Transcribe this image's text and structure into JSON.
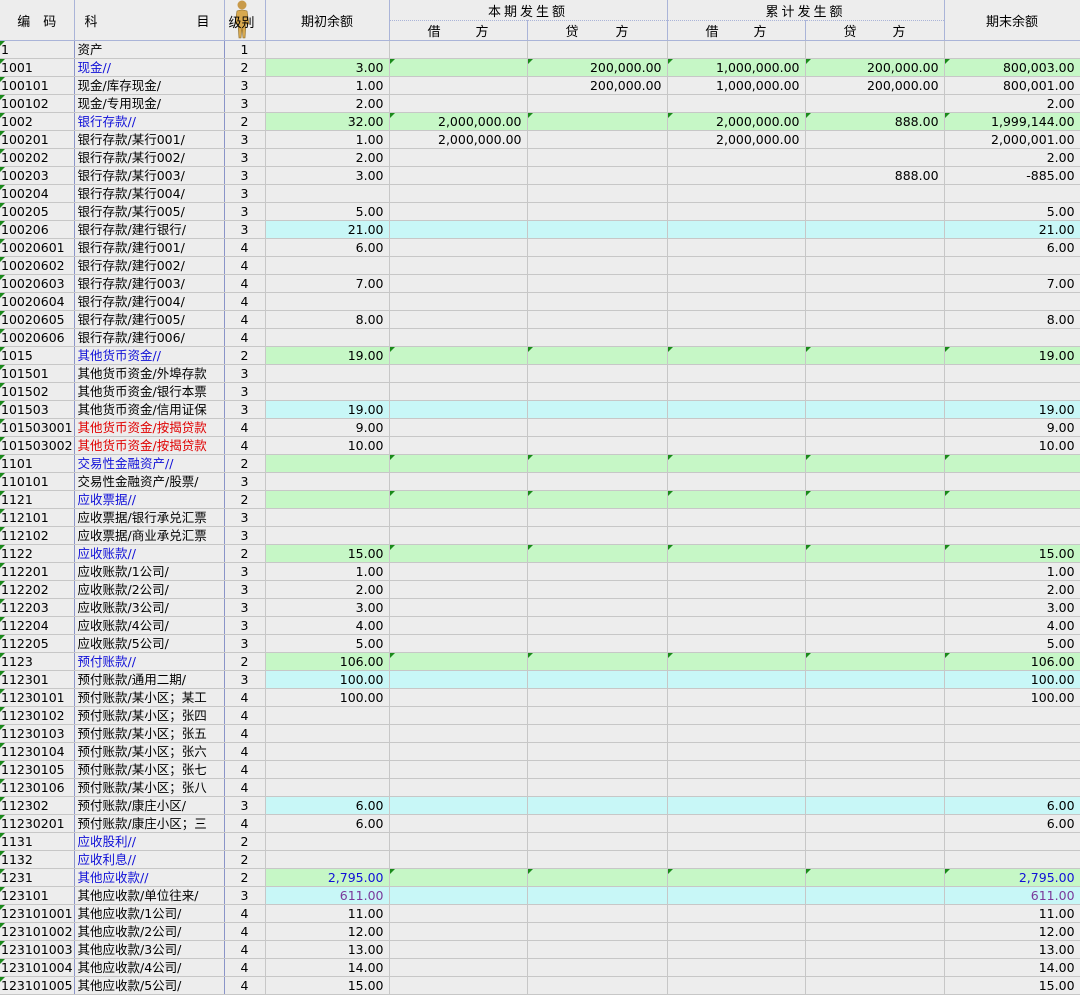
{
  "header": {
    "code": "编　码",
    "name_left": "科",
    "name_right": "目",
    "level": "级别",
    "opening": "期初余额",
    "period": "本期发生额",
    "cumulative": "累计发生额",
    "closing": "期末余额",
    "debit_left": "借",
    "debit_right": "方",
    "credit_left": "贷",
    "credit_right": "方"
  },
  "colors": {
    "header_bg": "#ededed",
    "cell_bg": "#ededed",
    "green_row": "#c6f7c6",
    "cyan_row": "#c8f7f7",
    "blue_text": "#1010d8",
    "red_text": "#e00000"
  },
  "rows": [
    {
      "code": "1",
      "name": "资产",
      "level": "1",
      "opening": "",
      "pd": "",
      "pc": "",
      "cd": "",
      "cc": "",
      "closing": "",
      "style": "",
      "nameColor": "",
      "numColor": ""
    },
    {
      "code": "1001",
      "name": "现金//",
      "level": "2",
      "opening": "3.00",
      "pd": "",
      "pc": "200,000.00",
      "cd": "1,000,000.00",
      "cc": "200,000.00",
      "closing": "800,003.00",
      "style": "green",
      "nameColor": "blue",
      "numColor": ""
    },
    {
      "code": "100101",
      "name": "现金/库存现金/",
      "level": "3",
      "opening": "1.00",
      "pd": "",
      "pc": "200,000.00",
      "cd": "1,000,000.00",
      "cc": "200,000.00",
      "closing": "800,001.00",
      "style": "",
      "nameColor": "",
      "numColor": ""
    },
    {
      "code": "100102",
      "name": "现金/专用现金/",
      "level": "3",
      "opening": "2.00",
      "pd": "",
      "pc": "",
      "cd": "",
      "cc": "",
      "closing": "2.00",
      "style": "",
      "nameColor": "",
      "numColor": ""
    },
    {
      "code": "1002",
      "name": "银行存款//",
      "level": "2",
      "opening": "32.00",
      "pd": "2,000,000.00",
      "pc": "",
      "cd": "2,000,000.00",
      "cc": "888.00",
      "closing": "1,999,144.00",
      "style": "green",
      "nameColor": "blue",
      "numColor": ""
    },
    {
      "code": "100201",
      "name": "银行存款/某行001/",
      "level": "3",
      "opening": "1.00",
      "pd": "2,000,000.00",
      "pc": "",
      "cd": "2,000,000.00",
      "cc": "",
      "closing": "2,000,001.00",
      "style": "",
      "nameColor": "",
      "numColor": ""
    },
    {
      "code": "100202",
      "name": "银行存款/某行002/",
      "level": "3",
      "opening": "2.00",
      "pd": "",
      "pc": "",
      "cd": "",
      "cc": "",
      "closing": "2.00",
      "style": "",
      "nameColor": "",
      "numColor": ""
    },
    {
      "code": "100203",
      "name": "银行存款/某行003/",
      "level": "3",
      "opening": "3.00",
      "pd": "",
      "pc": "",
      "cd": "",
      "cc": "888.00",
      "closing": "-885.00",
      "style": "",
      "nameColor": "",
      "numColor": ""
    },
    {
      "code": "100204",
      "name": "银行存款/某行004/",
      "level": "3",
      "opening": "",
      "pd": "",
      "pc": "",
      "cd": "",
      "cc": "",
      "closing": "",
      "style": "",
      "nameColor": "",
      "numColor": ""
    },
    {
      "code": "100205",
      "name": "银行存款/某行005/",
      "level": "3",
      "opening": "5.00",
      "pd": "",
      "pc": "",
      "cd": "",
      "cc": "",
      "closing": "5.00",
      "style": "",
      "nameColor": "",
      "numColor": ""
    },
    {
      "code": "100206",
      "name": "银行存款/建行银行/",
      "level": "3",
      "opening": "21.00",
      "pd": "",
      "pc": "",
      "cd": "",
      "cc": "",
      "closing": "21.00",
      "style": "cyan",
      "nameColor": "",
      "numColor": ""
    },
    {
      "code": "10020601",
      "name": "银行存款/建行001/",
      "level": "4",
      "opening": "6.00",
      "pd": "",
      "pc": "",
      "cd": "",
      "cc": "",
      "closing": "6.00",
      "style": "",
      "nameColor": "",
      "numColor": ""
    },
    {
      "code": "10020602",
      "name": "银行存款/建行002/",
      "level": "4",
      "opening": "",
      "pd": "",
      "pc": "",
      "cd": "",
      "cc": "",
      "closing": "",
      "style": "",
      "nameColor": "",
      "numColor": ""
    },
    {
      "code": "10020603",
      "name": "银行存款/建行003/",
      "level": "4",
      "opening": "7.00",
      "pd": "",
      "pc": "",
      "cd": "",
      "cc": "",
      "closing": "7.00",
      "style": "",
      "nameColor": "",
      "numColor": ""
    },
    {
      "code": "10020604",
      "name": "银行存款/建行004/",
      "level": "4",
      "opening": "",
      "pd": "",
      "pc": "",
      "cd": "",
      "cc": "",
      "closing": "",
      "style": "",
      "nameColor": "",
      "numColor": ""
    },
    {
      "code": "10020605",
      "name": "银行存款/建行005/",
      "level": "4",
      "opening": "8.00",
      "pd": "",
      "pc": "",
      "cd": "",
      "cc": "",
      "closing": "8.00",
      "style": "",
      "nameColor": "",
      "numColor": ""
    },
    {
      "code": "10020606",
      "name": "银行存款/建行006/",
      "level": "4",
      "opening": "",
      "pd": "",
      "pc": "",
      "cd": "",
      "cc": "",
      "closing": "",
      "style": "",
      "nameColor": "",
      "numColor": ""
    },
    {
      "code": "1015",
      "name": "其他货币资金//",
      "level": "2",
      "opening": "19.00",
      "pd": "",
      "pc": "",
      "cd": "",
      "cc": "",
      "closing": "19.00",
      "style": "green",
      "nameColor": "blue",
      "numColor": ""
    },
    {
      "code": "101501",
      "name": "其他货币资金/外埠存款",
      "level": "3",
      "opening": "",
      "pd": "",
      "pc": "",
      "cd": "",
      "cc": "",
      "closing": "",
      "style": "",
      "nameColor": "",
      "numColor": ""
    },
    {
      "code": "101502",
      "name": "其他货币资金/银行本票",
      "level": "3",
      "opening": "",
      "pd": "",
      "pc": "",
      "cd": "",
      "cc": "",
      "closing": "",
      "style": "",
      "nameColor": "",
      "numColor": ""
    },
    {
      "code": "101503",
      "name": "其他货币资金/信用证保",
      "level": "3",
      "opening": "19.00",
      "pd": "",
      "pc": "",
      "cd": "",
      "cc": "",
      "closing": "19.00",
      "style": "cyan",
      "nameColor": "",
      "numColor": ""
    },
    {
      "code": "101503001",
      "name": "其他货币资金/按揭贷款",
      "level": "4",
      "opening": "9.00",
      "pd": "",
      "pc": "",
      "cd": "",
      "cc": "",
      "closing": "9.00",
      "style": "",
      "nameColor": "red",
      "numColor": ""
    },
    {
      "code": "101503002",
      "name": "其他货币资金/按揭贷款",
      "level": "4",
      "opening": "10.00",
      "pd": "",
      "pc": "",
      "cd": "",
      "cc": "",
      "closing": "10.00",
      "style": "",
      "nameColor": "red",
      "numColor": ""
    },
    {
      "code": "1101",
      "name": "交易性金融资产//",
      "level": "2",
      "opening": "",
      "pd": "",
      "pc": "",
      "cd": "",
      "cc": "",
      "closing": "",
      "style": "green",
      "nameColor": "blue",
      "numColor": ""
    },
    {
      "code": "110101",
      "name": "交易性金融资产/股票/",
      "level": "3",
      "opening": "",
      "pd": "",
      "pc": "",
      "cd": "",
      "cc": "",
      "closing": "",
      "style": "",
      "nameColor": "",
      "numColor": ""
    },
    {
      "code": "1121",
      "name": "应收票据//",
      "level": "2",
      "opening": "",
      "pd": "",
      "pc": "",
      "cd": "",
      "cc": "",
      "closing": "",
      "style": "green",
      "nameColor": "blue",
      "numColor": ""
    },
    {
      "code": "112101",
      "name": "应收票据/银行承兑汇票",
      "level": "3",
      "opening": "",
      "pd": "",
      "pc": "",
      "cd": "",
      "cc": "",
      "closing": "",
      "style": "",
      "nameColor": "",
      "numColor": ""
    },
    {
      "code": "112102",
      "name": "应收票据/商业承兑汇票",
      "level": "3",
      "opening": "",
      "pd": "",
      "pc": "",
      "cd": "",
      "cc": "",
      "closing": "",
      "style": "",
      "nameColor": "",
      "numColor": ""
    },
    {
      "code": "1122",
      "name": "应收账款//",
      "level": "2",
      "opening": "15.00",
      "pd": "",
      "pc": "",
      "cd": "",
      "cc": "",
      "closing": "15.00",
      "style": "green",
      "nameColor": "blue",
      "numColor": ""
    },
    {
      "code": "112201",
      "name": "应收账款/1公司/",
      "level": "3",
      "opening": "1.00",
      "pd": "",
      "pc": "",
      "cd": "",
      "cc": "",
      "closing": "1.00",
      "style": "",
      "nameColor": "",
      "numColor": ""
    },
    {
      "code": "112202",
      "name": "应收账款/2公司/",
      "level": "3",
      "opening": "2.00",
      "pd": "",
      "pc": "",
      "cd": "",
      "cc": "",
      "closing": "2.00",
      "style": "",
      "nameColor": "",
      "numColor": ""
    },
    {
      "code": "112203",
      "name": "应收账款/3公司/",
      "level": "3",
      "opening": "3.00",
      "pd": "",
      "pc": "",
      "cd": "",
      "cc": "",
      "closing": "3.00",
      "style": "",
      "nameColor": "",
      "numColor": ""
    },
    {
      "code": "112204",
      "name": "应收账款/4公司/",
      "level": "3",
      "opening": "4.00",
      "pd": "",
      "pc": "",
      "cd": "",
      "cc": "",
      "closing": "4.00",
      "style": "",
      "nameColor": "",
      "numColor": ""
    },
    {
      "code": "112205",
      "name": "应收账款/5公司/",
      "level": "3",
      "opening": "5.00",
      "pd": "",
      "pc": "",
      "cd": "",
      "cc": "",
      "closing": "5.00",
      "style": "",
      "nameColor": "",
      "numColor": ""
    },
    {
      "code": "1123",
      "name": "预付账款//",
      "level": "2",
      "opening": "106.00",
      "pd": "",
      "pc": "",
      "cd": "",
      "cc": "",
      "closing": "106.00",
      "style": "green",
      "nameColor": "blue",
      "numColor": ""
    },
    {
      "code": "112301",
      "name": "预付账款/通用二期/",
      "level": "3",
      "opening": "100.00",
      "pd": "",
      "pc": "",
      "cd": "",
      "cc": "",
      "closing": "100.00",
      "style": "cyan",
      "nameColor": "",
      "numColor": ""
    },
    {
      "code": "11230101",
      "name": "预付账款/某小区；某工",
      "level": "4",
      "opening": "100.00",
      "pd": "",
      "pc": "",
      "cd": "",
      "cc": "",
      "closing": "100.00",
      "style": "",
      "nameColor": "",
      "numColor": ""
    },
    {
      "code": "11230102",
      "name": "预付账款/某小区；张四",
      "level": "4",
      "opening": "",
      "pd": "",
      "pc": "",
      "cd": "",
      "cc": "",
      "closing": "",
      "style": "",
      "nameColor": "",
      "numColor": ""
    },
    {
      "code": "11230103",
      "name": "预付账款/某小区；张五",
      "level": "4",
      "opening": "",
      "pd": "",
      "pc": "",
      "cd": "",
      "cc": "",
      "closing": "",
      "style": "",
      "nameColor": "",
      "numColor": ""
    },
    {
      "code": "11230104",
      "name": "预付账款/某小区；张六",
      "level": "4",
      "opening": "",
      "pd": "",
      "pc": "",
      "cd": "",
      "cc": "",
      "closing": "",
      "style": "",
      "nameColor": "",
      "numColor": ""
    },
    {
      "code": "11230105",
      "name": "预付账款/某小区；张七",
      "level": "4",
      "opening": "",
      "pd": "",
      "pc": "",
      "cd": "",
      "cc": "",
      "closing": "",
      "style": "",
      "nameColor": "",
      "numColor": ""
    },
    {
      "code": "11230106",
      "name": "预付账款/某小区；张八",
      "level": "4",
      "opening": "",
      "pd": "",
      "pc": "",
      "cd": "",
      "cc": "",
      "closing": "",
      "style": "",
      "nameColor": "",
      "numColor": ""
    },
    {
      "code": "112302",
      "name": "预付账款/康庄小区/",
      "level": "3",
      "opening": "6.00",
      "pd": "",
      "pc": "",
      "cd": "",
      "cc": "",
      "closing": "6.00",
      "style": "cyan",
      "nameColor": "",
      "numColor": ""
    },
    {
      "code": "11230201",
      "name": "预付账款/康庄小区；三",
      "level": "4",
      "opening": "6.00",
      "pd": "",
      "pc": "",
      "cd": "",
      "cc": "",
      "closing": "6.00",
      "style": "",
      "nameColor": "",
      "numColor": ""
    },
    {
      "code": "1131",
      "name": "应收股利//",
      "level": "2",
      "opening": "",
      "pd": "",
      "pc": "",
      "cd": "",
      "cc": "",
      "closing": "",
      "style": "",
      "nameColor": "blue",
      "numColor": ""
    },
    {
      "code": "1132",
      "name": "应收利息//",
      "level": "2",
      "opening": "",
      "pd": "",
      "pc": "",
      "cd": "",
      "cc": "",
      "closing": "",
      "style": "",
      "nameColor": "blue",
      "numColor": ""
    },
    {
      "code": "1231",
      "name": "其他应收款//",
      "level": "2",
      "opening": "2,795.00",
      "pd": "",
      "pc": "",
      "cd": "",
      "cc": "",
      "closing": "2,795.00",
      "style": "green",
      "nameColor": "blue",
      "numColor": "blue"
    },
    {
      "code": "123101",
      "name": "其他应收款/单位往来/",
      "level": "3",
      "opening": "611.00",
      "pd": "",
      "pc": "",
      "cd": "",
      "cc": "",
      "closing": "611.00",
      "style": "cyan",
      "nameColor": "",
      "numColor": "purple"
    },
    {
      "code": "123101001",
      "name": "其他应收款/1公司/",
      "level": "4",
      "opening": "11.00",
      "pd": "",
      "pc": "",
      "cd": "",
      "cc": "",
      "closing": "11.00",
      "style": "",
      "nameColor": "",
      "numColor": ""
    },
    {
      "code": "123101002",
      "name": "其他应收款/2公司/",
      "level": "4",
      "opening": "12.00",
      "pd": "",
      "pc": "",
      "cd": "",
      "cc": "",
      "closing": "12.00",
      "style": "",
      "nameColor": "",
      "numColor": ""
    },
    {
      "code": "123101003",
      "name": "其他应收款/3公司/",
      "level": "4",
      "opening": "13.00",
      "pd": "",
      "pc": "",
      "cd": "",
      "cc": "",
      "closing": "13.00",
      "style": "",
      "nameColor": "",
      "numColor": ""
    },
    {
      "code": "123101004",
      "name": "其他应收款/4公司/",
      "level": "4",
      "opening": "14.00",
      "pd": "",
      "pc": "",
      "cd": "",
      "cc": "",
      "closing": "14.00",
      "style": "",
      "nameColor": "",
      "numColor": ""
    },
    {
      "code": "123101005",
      "name": "其他应收款/5公司/",
      "level": "4",
      "opening": "15.00",
      "pd": "",
      "pc": "",
      "cd": "",
      "cc": "",
      "closing": "15.00",
      "style": "",
      "nameColor": "",
      "numColor": ""
    }
  ]
}
